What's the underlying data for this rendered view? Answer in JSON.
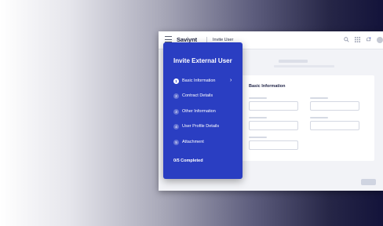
{
  "app": {
    "brand": "Saviynt",
    "breadcrumb": "Invite User"
  },
  "form": {
    "section_title": "Basic Information"
  },
  "wizard": {
    "title": "Invite External User",
    "steps": [
      {
        "number": "1",
        "label": "Basic Information",
        "active": true
      },
      {
        "number": "2",
        "label": "Contract Details",
        "active": false
      },
      {
        "number": "3",
        "label": "Other Information",
        "active": false
      },
      {
        "number": "4",
        "label": "User Profile Details",
        "active": false
      },
      {
        "number": "5",
        "label": "Attachment",
        "active": false
      }
    ],
    "progress": "0/5 Completed"
  },
  "icons": [
    "menu-icon",
    "search-icon",
    "apps-grid-icon",
    "notification-icon",
    "avatar",
    "chevron-right-icon"
  ],
  "colors": {
    "panel": "#2a3ec2",
    "brand_text": "#1d2240"
  }
}
